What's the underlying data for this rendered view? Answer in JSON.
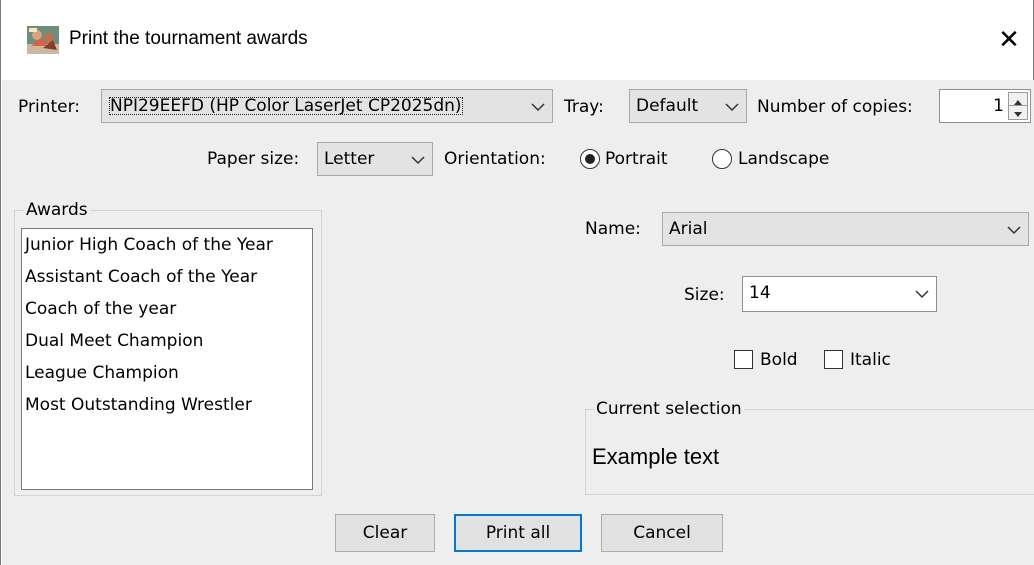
{
  "window": {
    "title": "Print the tournament awards",
    "close_glyph": "✕",
    "icon": "wrestling-app-icon"
  },
  "printer_row": {
    "printer_label": "Printer:",
    "printer_value": "NPI29EEFD (HP Color LaserJet CP2025dn)",
    "tray_label": "Tray:",
    "tray_value": "Default",
    "copies_label": "Number of copies:",
    "copies_value": "1"
  },
  "paper_row": {
    "paper_size_label": "Paper size:",
    "paper_size_value": "Letter",
    "orientation_label": "Orientation:",
    "portrait_label": "Portrait",
    "landscape_label": "Landscape",
    "selected_orientation": "Portrait"
  },
  "awards": {
    "group_title": "Awards",
    "items": [
      "Junior High Coach of the Year",
      "Assistant Coach of the Year",
      "Coach of the year",
      "Dual Meet Champion",
      "League Champion",
      "Most Outstanding Wrestler"
    ]
  },
  "font": {
    "name_label": "Name:",
    "name_value": "Arial",
    "size_label": "Size:",
    "size_value": "14",
    "bold_label": "Bold",
    "bold_checked": false,
    "italic_label": "Italic",
    "italic_checked": false
  },
  "current_selection": {
    "group_title": "Current selection",
    "example_text": "Example text"
  },
  "buttons": {
    "clear_label": "Clear",
    "print_all_label": "Print all",
    "cancel_label": "Cancel"
  },
  "colors": {
    "dialog_background": "#eeeeee",
    "default_button_border": "#0078d7",
    "combo_background": "#e3e3e3"
  }
}
